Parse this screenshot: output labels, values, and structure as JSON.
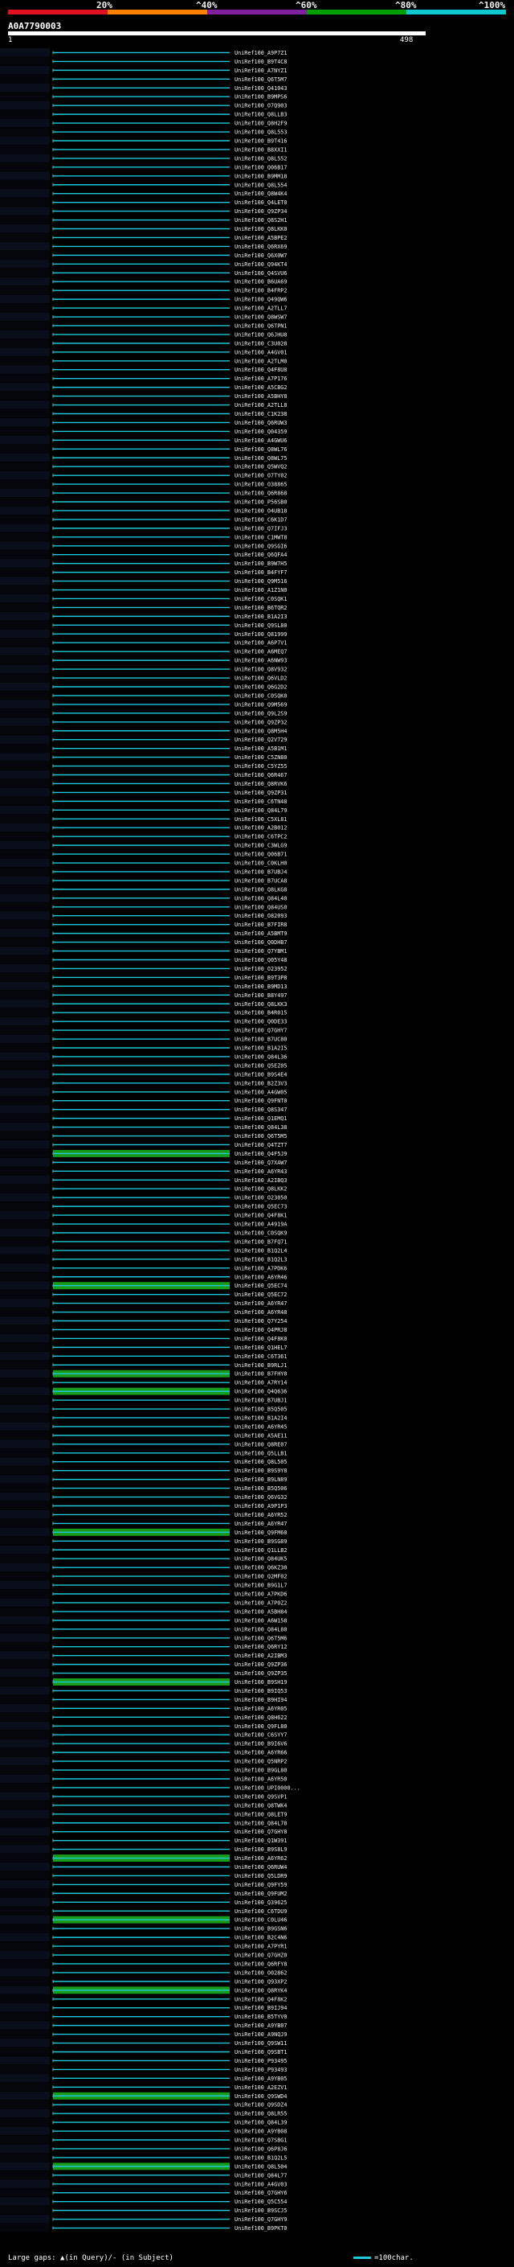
{
  "colors": {
    "background": "#000000",
    "identity_scale": [
      "#e01020",
      "#ff8000",
      "#8020a0",
      "#00a000",
      "#10c8d0"
    ],
    "hit_cyan": "#1ec8d8",
    "hit_green": "#1a9a1a"
  },
  "header": {
    "pct_labels": [
      "20%",
      "^40%",
      "^60%",
      "^80%",
      "^100%"
    ],
    "query_id": "A0A7790003",
    "query_start": "1",
    "query_end": "498"
  },
  "footer": {
    "gaps_label": "Large gaps: ▲(in Query)/- (in Subject)",
    "scale_label": "=100char."
  },
  "chart_data": {
    "type": "alignment-overview",
    "query_length": 498,
    "hit_ids": [
      "UniRef100_A9P7Z1",
      "UniRef100_B9T4C8",
      "UniRef100_A7NYZ1",
      "UniRef100_Q6T5M7",
      "UniRef100_Q41043",
      "UniRef100_B9MPS6",
      "UniRef100_O7Q903",
      "UniRef100_Q8LLB3",
      "UniRef100_Q8H2F9",
      "UniRef100_Q8L553",
      "UniRef100_B9T416",
      "UniRef100_B8XXI1",
      "UniRef100_Q8L552",
      "UniRef100_Q06B17",
      "UniRef100_B9MM18",
      "UniRef100_Q8L554",
      "UniRef100_Q8W4K4",
      "UniRef100_Q4LET0",
      "UniRef100_Q9ZP34",
      "UniRef100_Q8S2H1",
      "UniRef100_Q8LKK0",
      "UniRef100_A5BPE2",
      "UniRef100_Q6RX69",
      "UniRef100_Q6X0W7",
      "UniRef100_Q94KT4",
      "UniRef100_Q4SVU6",
      "UniRef100_B6UA69",
      "UniRef100_B4FRP2",
      "UniRef100_Q49QW6",
      "UniRef100_A2TLL7",
      "UniRef100_Q8WSW7",
      "UniRef100_Q6TPN1",
      "UniRef100_Q6JHU8",
      "UniRef100_C3U028",
      "UniRef100_A4GV01",
      "UniRef100_A2TLM0",
      "UniRef100_Q4F8U8",
      "UniRef100_A7P176",
      "UniRef100_A5CBG2",
      "UniRef100_A5BHY8",
      "UniRef100_A2TLL8",
      "UniRef100_C1K238",
      "UniRef100_Q6RUW3",
      "UniRef100_Q04359",
      "UniRef100_A4GWU6",
      "UniRef100_Q8WL76",
      "UniRef100_Q8WL75",
      "UniRef100_Q5WVQ2",
      "UniRef100_O7TY02",
      "UniRef100_O38865",
      "UniRef100_Q6R868",
      "UniRef100_P56SB0",
      "UniRef100_O4UB18",
      "UniRef100_C6K1D7",
      "UniRef100_Q7IFJ3",
      "UniRef100_C1MWT8",
      "UniRef100_Q9SGI6",
      "UniRef100_Q6QFA4",
      "UniRef100_B9W7H5",
      "UniRef100_B4FYF7",
      "UniRef100_Q9M516",
      "UniRef100_A1Z1N0",
      "UniRef100_C0SQK1",
      "UniRef100_B6TQR2",
      "UniRef100_B1A2I3",
      "UniRef100_Q9SL80",
      "UniRef100_Q81999",
      "UniRef100_A6P7V1",
      "UniRef100_A6MEQ7",
      "UniRef100_A6NW93",
      "UniRef100_Q8V932",
      "UniRef100_Q6VLD2",
      "UniRef100_Q6G2D2",
      "UniRef100_C0SQK0",
      "UniRef100_Q9M569",
      "UniRef100_Q9L2S9",
      "UniRef100_Q9ZP32",
      "UniRef100_Q8M5H4",
      "UniRef100_Q2V729",
      "UniRef100_A5B1M1",
      "UniRef100_C5ZN80",
      "UniRef100_C5YZ55",
      "UniRef100_Q6R467",
      "UniRef100_Q8RVK6",
      "UniRef100_Q9ZP31",
      "UniRef100_C6TN48",
      "UniRef100_Q84L79",
      "UniRef100_C5XL81",
      "UniRef100_A2B012",
      "UniRef100_C6TPC2",
      "UniRef100_C3WLG9",
      "UniRef100_Q06B71",
      "UniRef100_C0KLH0",
      "UniRef100_B7UBJ4",
      "UniRef100_B7UCA8",
      "UniRef100_Q8LKG8",
      "UniRef100_Q84L40",
      "UniRef100_Q84US0",
      "UniRef100_O82093",
      "UniRef100_B7FIR8",
      "UniRef100_A5BMT9",
      "UniRef100_Q0DHB7",
      "UniRef100_Q7YBM1",
      "UniRef100_Q05Y48",
      "UniRef100_O23952",
      "UniRef100_B9T3P8",
      "UniRef100_B9MD13",
      "UniRef100_B8Y497",
      "UniRef100_Q8LKK3",
      "UniRef100_B4R015",
      "UniRef100_Q0DE33",
      "UniRef100_Q7GHY7",
      "UniRef100_B7UC80",
      "UniRef100_B1A2I5",
      "UniRef100_Q84L36",
      "UniRef100_Q5EZ05",
      "UniRef100_B9S4E4",
      "UniRef100_B2Z3V3",
      "UniRef100_A4GW05",
      "UniRef100_Q9FNT0",
      "UniRef100_Q8S347",
      "UniRef100_Q1EMQ1",
      "UniRef100_Q84L38",
      "UniRef100_Q6T5M5",
      "UniRef100_Q4TZT7",
      "UniRef100_Q4F5J9",
      "UniRef100_Q7XAW7",
      "UniRef100_A6YR43",
      "UniRef100_A2IBQ3",
      "UniRef100_Q8LKK2",
      "UniRef100_O23050",
      "UniRef100_Q5EC73",
      "UniRef100_Q4F8K1",
      "UniRef100_A4919A",
      "UniRef100_C0SQK9",
      "UniRef100_B7FQ71",
      "UniRef100_B1Q2L4",
      "UniRef100_B1Q2L3",
      "UniRef100_A7PDK6",
      "UniRef100_A6YR46",
      "UniRef100_Q5EC74",
      "UniRef100_Q5EC72",
      "UniRef100_A6YR47",
      "UniRef100_A6YR48",
      "UniRef100_Q7Y254",
      "UniRef100_Q4PRJ8",
      "UniRef100_Q4F8K0",
      "UniRef100_Q1HEL7",
      "UniRef100_C6T361",
      "UniRef100_B9RLJ1",
      "UniRef100_B7FHY0",
      "UniRef100_A7RY14",
      "UniRef100_Q4Q636",
      "UniRef100_B7UBJ1",
      "UniRef100_B5Q505",
      "UniRef100_B1A2I4",
      "UniRef100_A6YR45",
      "UniRef100_A5AE11",
      "UniRef100_Q8RE07",
      "UniRef100_Q5LLB1",
      "UniRef100_Q8L505",
      "UniRef100_B9S9Y8",
      "UniRef100_B9LN89",
      "UniRef100_B5Q506",
      "UniRef100_Q6VG32",
      "UniRef100_A9P1P3",
      "UniRef100_A6YR52",
      "UniRef100_A6YR47",
      "UniRef100_Q9FM60",
      "UniRef100_B9SG89",
      "UniRef100_Q1LLB2",
      "UniRef100_Q84UK5",
      "UniRef100_Q6KZ30",
      "UniRef100_Q2MF02",
      "UniRef100_B9G1L7",
      "UniRef100_A7PKD6",
      "UniRef100_A7P0Z2",
      "UniRef100_A5BH84",
      "UniRef100_A6W158",
      "UniRef100_Q84L80",
      "UniRef100_Q6T5M6",
      "UniRef100_Q6RY12",
      "UniRef100_A2IBM3",
      "UniRef100_Q9ZP36",
      "UniRef100_Q9ZP35",
      "UniRef100_B9SH19",
      "UniRef100_B9IQ53",
      "UniRef100_B9HI94",
      "UniRef100_A6YR05",
      "UniRef100_Q8H622",
      "UniRef100_Q9FL80",
      "UniRef100_C6SYY7",
      "UniRef100_B9I6V6",
      "UniRef100_A6YR66",
      "UniRef100_Q5NRP2",
      "UniRef100_B9GL80",
      "UniRef100_A6YR50",
      "UniRef100_UPI0000...",
      "UniRef100_Q9SVP1",
      "UniRef100_Q8TWK4",
      "UniRef100_Q8LET9",
      "UniRef100_Q84L78",
      "UniRef100_Q7GHY8",
      "UniRef100_Q1W391",
      "UniRef100_B9S8L9",
      "UniRef100_A6YR62",
      "UniRef100_Q6RUW4",
      "UniRef100_Q5LDR9",
      "UniRef100_Q9FY59",
      "UniRef100_Q9FUM2",
      "UniRef100_Q39625",
      "UniRef100_C6TDU9",
      "UniRef100_C0LU46",
      "UniRef100_B9GSN6",
      "UniRef100_B2C4N6",
      "UniRef100_A7PYR1",
      "UniRef100_Q7GHZ0",
      "UniRef100_Q6RFY8",
      "UniRef100_O02862",
      "UniRef100_Q93XP2",
      "UniRef100_Q8RYK4",
      "UniRef100_Q4F8K2",
      "UniRef100_B9IJ94",
      "UniRef100_B5TYV0",
      "UniRef100_A9YB07",
      "UniRef100_A9NQJ9",
      "UniRef100_Q9SW11",
      "UniRef100_Q9SBT1",
      "UniRef100_P93495",
      "UniRef100_P93493",
      "UniRef100_A9YB05",
      "UniRef100_A2EZV1",
      "UniRef100_Q9SWD4",
      "UniRef100_Q9SDZ4",
      "UniRef100_Q8LR55",
      "UniRef100_Q84L39",
      "UniRef100_A9YB08",
      "UniRef100_Q7SBG1",
      "UniRef100_Q6P8J6",
      "UniRef100_B1Q2L5",
      "UniRef100_Q8L504",
      "UniRef100_Q84L77",
      "UniRef100_A4GV03",
      "UniRef100_Q7GHY6",
      "UniRef100_Q5C554",
      "UniRef100_B9SCJ5",
      "UniRef100_Q7GHY9",
      "UniRef100_B9PKT0"
    ]
  }
}
